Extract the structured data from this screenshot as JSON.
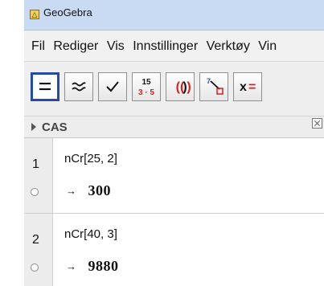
{
  "window": {
    "title": "GeoGebra"
  },
  "menu": {
    "items": [
      "Fil",
      "Rediger",
      "Vis",
      "Innstillinger",
      "Verktøy",
      "Vin"
    ]
  },
  "toolbar": {
    "tools": [
      {
        "name": "evaluate",
        "icon": "equals-icon",
        "active": true
      },
      {
        "name": "numeric",
        "icon": "approx-icon",
        "active": false
      },
      {
        "name": "keep-input",
        "icon": "checkmark-icon",
        "active": false
      },
      {
        "name": "factor",
        "icon": "factor-icon",
        "label_top": "15",
        "label_bottom": "3 · 5",
        "active": false
      },
      {
        "name": "expand",
        "icon": "parentheses-icon",
        "active": false
      },
      {
        "name": "substitute",
        "icon": "substitute-icon",
        "label": "7",
        "active": false
      },
      {
        "name": "solve",
        "icon": "solve-icon",
        "label": "x=",
        "active": false
      }
    ]
  },
  "cas": {
    "title": "CAS",
    "rows": [
      {
        "number": "1",
        "input": "nCr[25, 2]",
        "arrow": "→",
        "output": "300"
      },
      {
        "number": "2",
        "input": "nCr[40, 3]",
        "arrow": "→",
        "output": "9880"
      }
    ]
  },
  "colors": {
    "titlebar": "#c8dbf3",
    "active_tool_border": "#274aa6",
    "factor_red": "#d61f1f"
  }
}
